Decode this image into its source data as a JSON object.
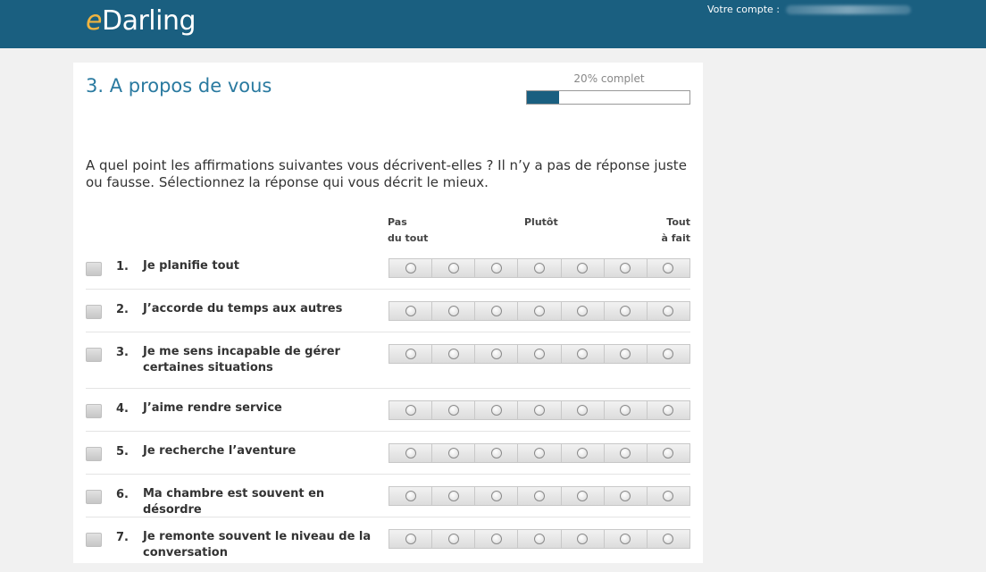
{
  "header": {
    "logo_e": "e",
    "logo_rest": "Darling",
    "account_label": "Votre compte :"
  },
  "section": {
    "title": "3. A propos de vous",
    "progress_label": "20% complet",
    "progress_fraction": 0.2
  },
  "intro": "A quel point les affirmations suivantes vous décrivent-elles ? Il n’y a pas de réponse juste ou fausse. Sélectionnez la réponse qui vous décrit le mieux.",
  "scale_headers": {
    "left_line1": "Pas",
    "left_line2": "du tout",
    "middle": "Plutôt",
    "right_line1": "Tout",
    "right_line2": "à fait"
  },
  "colors": {
    "header_bg": "#1a5f80",
    "title": "#2a7aa0",
    "logo_accent": "#f0b440"
  },
  "questions": [
    {
      "num": "1.",
      "text": "Je planifie tout"
    },
    {
      "num": "2.",
      "text": "J’accorde du temps aux autres"
    },
    {
      "num": "3.",
      "text": "Je me sens incapable de gérer certaines situations"
    },
    {
      "num": "4.",
      "text": "J’aime rendre service"
    },
    {
      "num": "5.",
      "text": "Je recherche l’aventure"
    },
    {
      "num": "6.",
      "text": "Ma chambre est souvent en désordre"
    },
    {
      "num": "7.",
      "text": "Je remonte souvent le niveau de la conversation"
    }
  ],
  "scale_points": 7
}
